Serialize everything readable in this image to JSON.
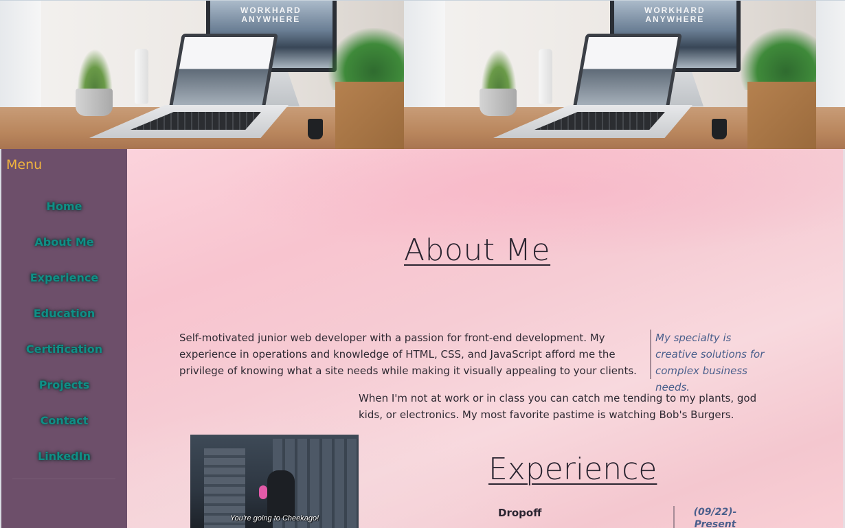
{
  "banner": {
    "monitor_text": "WORKHARD\nANYWHERE",
    "monitor_line1": "WORKHARD",
    "monitor_line2": "ANYWHERE"
  },
  "sidebar": {
    "title": "Menu",
    "items": [
      {
        "label": "Home"
      },
      {
        "label": "About Me"
      },
      {
        "label": "Experience"
      },
      {
        "label": "Education"
      },
      {
        "label": "Certification"
      },
      {
        "label": "Projects"
      },
      {
        "label": "Contact"
      },
      {
        "label": "LinkedIn"
      }
    ]
  },
  "about": {
    "title": "About Me",
    "intro": "Self-motivated junior web developer with a passion for front-end development. My experience in operations and knowledge of HTML, CSS, and JavaScript afford me the privilege of knowing what a site needs while making it visually appealing to your clients.",
    "quote": "My specialty is creative solutions for complex business needs.",
    "hobbies": "When I'm not at work or in class you can catch me tending to my plants, god kids, or electronics. My most favorite pastime is watching Bob's Burgers.",
    "gif_caption": "You're going to Cheekago!"
  },
  "experience": {
    "title": "Experience",
    "jobs": [
      {
        "company": "Dropoff",
        "date_start": "(09/22)-",
        "date_end": "Present"
      }
    ]
  },
  "colors": {
    "sidebar_bg": "#6d4f6a",
    "menu_title": "#f2b53d",
    "nav_link": "#0f8f86",
    "quote_text": "#4a5f8c",
    "content_bg": "#f8c4cf"
  }
}
